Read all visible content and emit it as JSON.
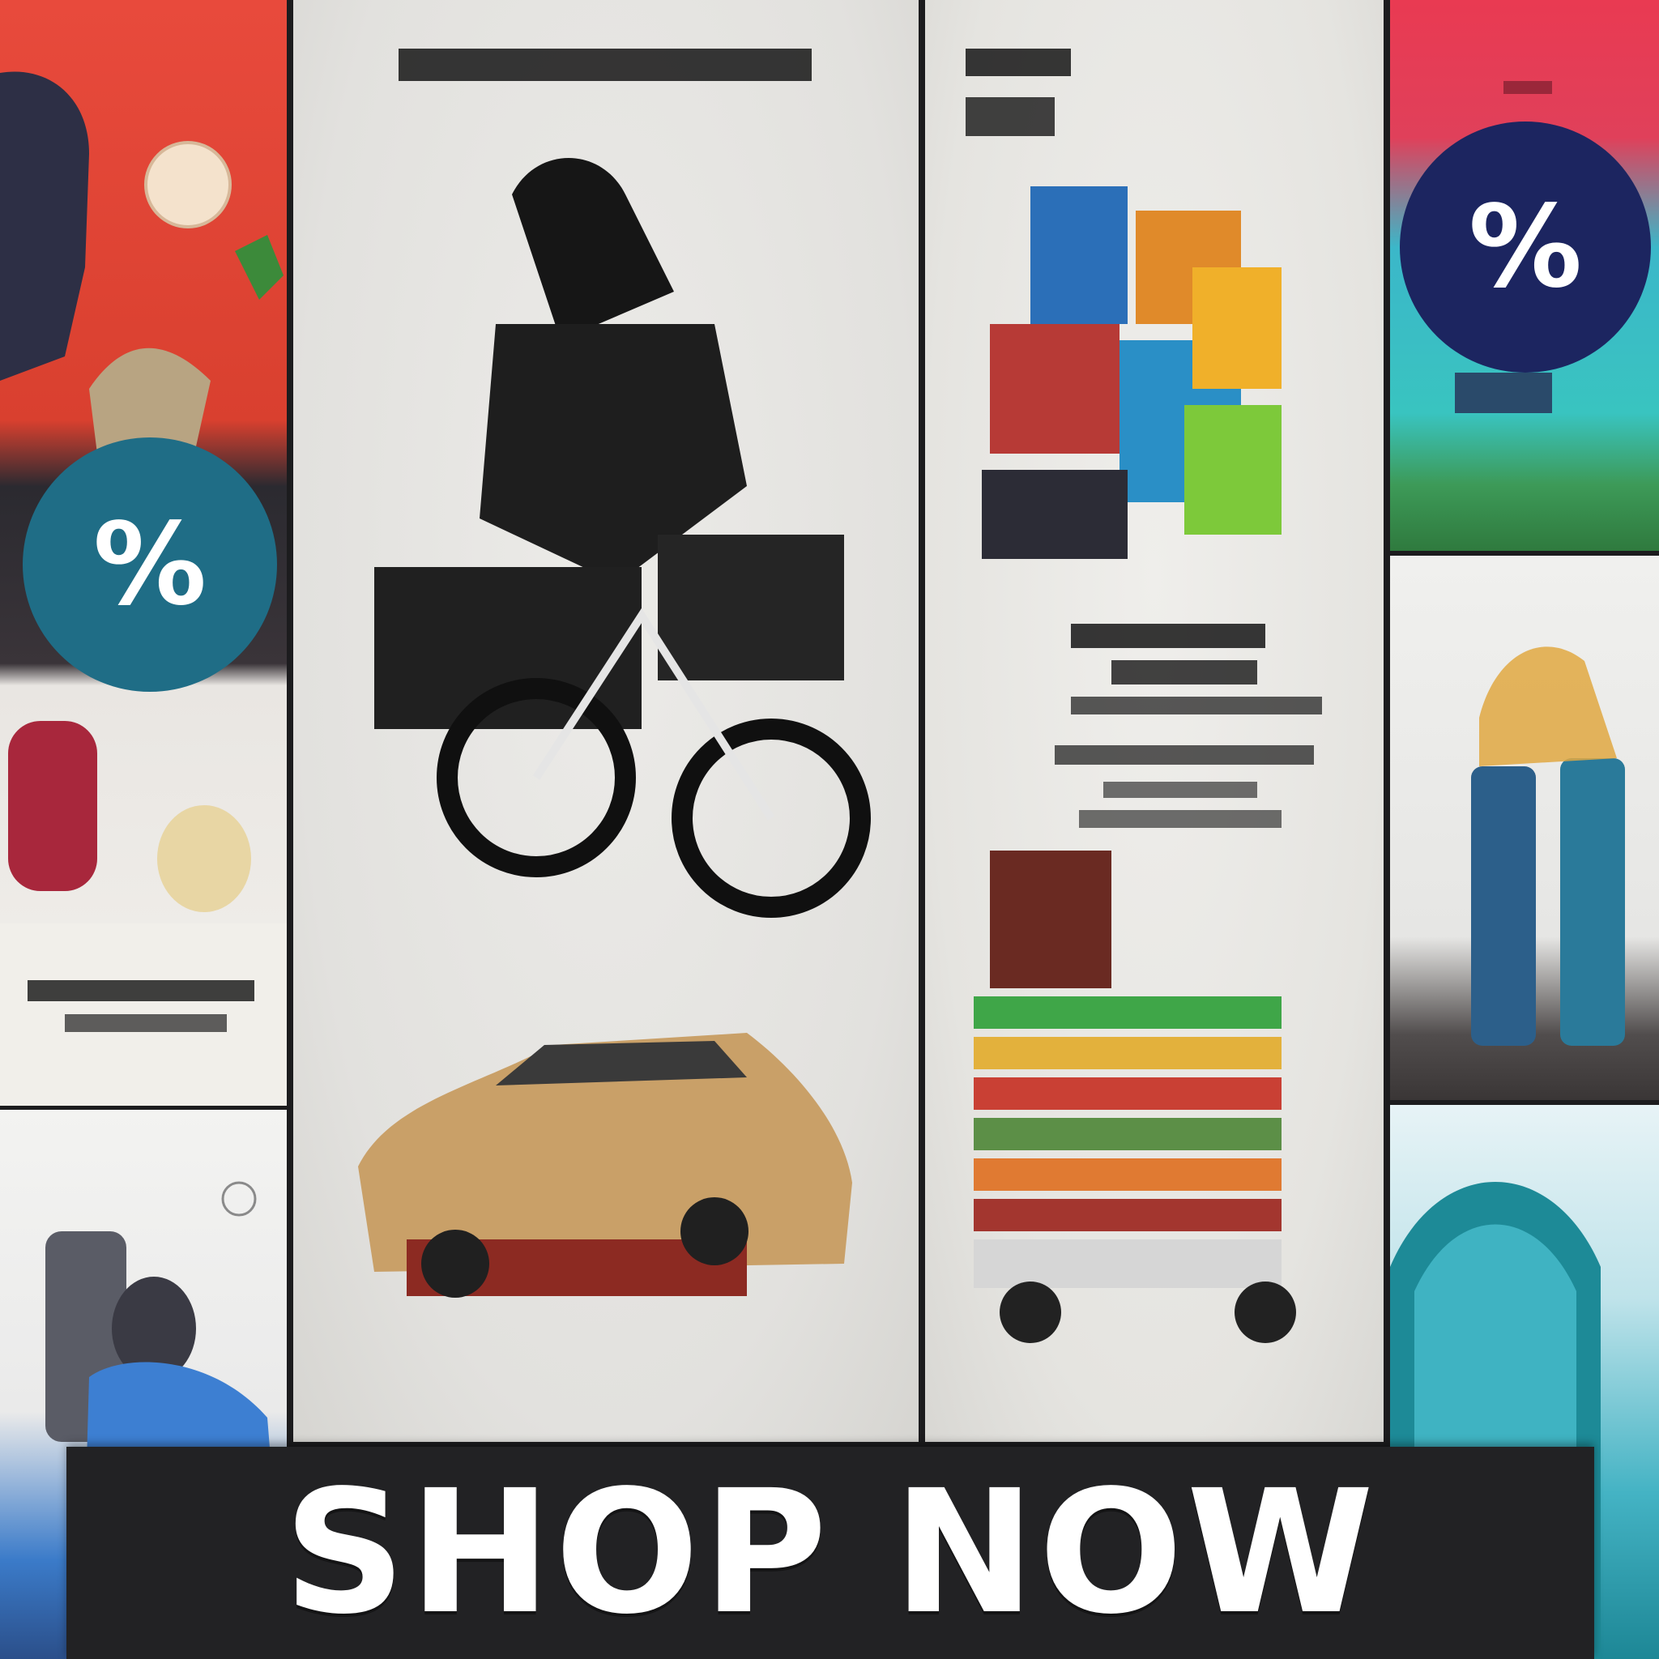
{
  "cta": {
    "label": "SHOP NOW"
  },
  "badges": {
    "left": {
      "symbol": "%",
      "color": "#1f6d86"
    },
    "right": {
      "symbol": "%",
      "color": "#1c2560"
    }
  },
  "colors": {
    "cta_background": "#222224",
    "cta_text": "#ffffff",
    "panel_red": "#e84a3c",
    "panel_pink": "#e93a52",
    "poster_background": "#e8e7e4"
  },
  "icons": [
    "motorcycle-illustration",
    "car-illustration",
    "shopping-goods-illustration",
    "percent-badge",
    "product-bottles-illustration"
  ]
}
